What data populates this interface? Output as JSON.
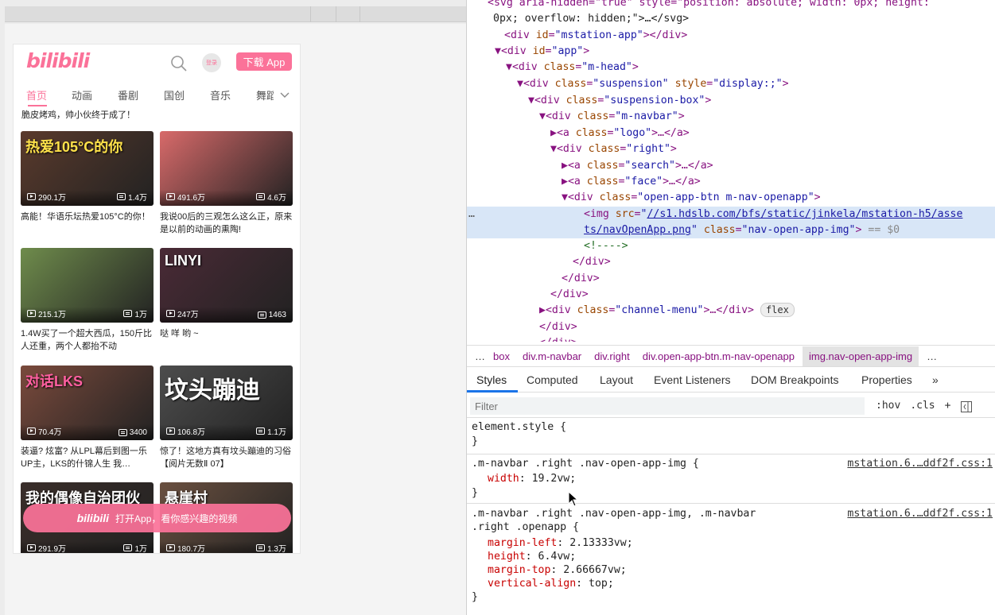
{
  "mobile": {
    "logo": "bilibili",
    "face_label": "登录",
    "open_app_label": "下载 App",
    "channels": [
      "首页",
      "动画",
      "番剧",
      "国创",
      "音乐",
      "舞蹈"
    ],
    "prev_title": "脆皮烤鸡，帅小伙终于成了！",
    "cards": [
      {
        "views": "290.1万",
        "danmaku": "1.4万",
        "title": "高能！华语乐坛热爱105°C的你！",
        "thumb_text": "热爱105°C的你",
        "bg": "#5a3a2c"
      },
      {
        "views": "491.6万",
        "danmaku": "4.6万",
        "title": "我说00后的三观怎么这么正，原来是以前的动画的熏陶!",
        "thumb_text": "",
        "bg": "#d86a6a"
      },
      {
        "views": "215.1万",
        "danmaku": "1万",
        "title": "1.4W买了一个超大西瓜，150斤比人还重，两个人都抬不动",
        "thumb_text": "",
        "bg": "#6f8c4c"
      },
      {
        "views": "247万",
        "danmaku": "1463",
        "title": "哒 咩 哟 ~",
        "thumb_text": "LINYI",
        "bg": "#4a2a36"
      },
      {
        "views": "70.4万",
        "danmaku": "3400",
        "title": "装逼? 炫富? 从LPL幕后到图一乐UP主，LKS的什锦人生 我…",
        "thumb_text": "对话LKS",
        "bg": "#7a4a3c"
      },
      {
        "views": "106.8万",
        "danmaku": "1.1万",
        "title": "惊了！这地方真有坟头蹦迪的习俗【阅片无数Ⅱ 07】",
        "thumb_text": "坟头蹦迪",
        "bg": "#4d4d4d"
      },
      {
        "views": "291.9万",
        "danmaku": "1万",
        "title": "",
        "thumb_text": "我的偶像自治团伙",
        "bg": "#3a2e2a"
      },
      {
        "views": "180.7万",
        "danmaku": "1.3万",
        "title": "",
        "thumb_text": "悬崖村",
        "bg": "#6a5040"
      }
    ],
    "float_banner": {
      "logo": "bilibili",
      "text": "打开App，看你感兴趣的视频"
    }
  },
  "devtools": {
    "elements": {
      "line0": "<svg aria-hidden=\"true\" style=\"position: absolute; width: 0px; height:",
      "line0b": "0px; overflow: hidden;\">…</svg>",
      "mstation": "mstation-app",
      "app": "app",
      "m_head": "m-head",
      "suspension": "suspension",
      "suspension_style": "display:;",
      "suspension_box": "suspension-box",
      "m_navbar": "m-navbar",
      "logo": "logo",
      "right": "right",
      "search": "search",
      "face": "face",
      "open_app_btn": "open-app-btn m-nav-openapp",
      "img_src_1": "//s1.hdslb.com/bfs/static/jinkela/mstation-h5/asse",
      "img_src_2": "ts/navOpenApp.png",
      "img_class": "nav-open-app-img",
      "dollar": "== $0",
      "comment": "<!---->",
      "channel_menu": "channel-menu",
      "flex_badge": "flex"
    },
    "breadcrumb": [
      "…",
      "box",
      "div.m-navbar",
      "div.right",
      "div.open-app-btn.m-nav-openapp",
      "img.nav-open-app-img",
      "…"
    ],
    "tabs": [
      "Styles",
      "Computed",
      "Layout",
      "Event Listeners",
      "DOM Breakpoints",
      "Properties",
      "»"
    ],
    "filter_placeholder": "Filter",
    "filter_tools": [
      ":hov",
      ".cls",
      "+"
    ],
    "rules": {
      "element_style": "element.style {",
      "close": "}",
      "r1_selector": ".m-navbar .right .nav-open-app-img {",
      "r1_source": "mstation.6.…ddf2f.css:1",
      "r1_prop": "width",
      "r1_val": "19.2vw;",
      "r2_selector_1": ".m-navbar .right .nav-open-app-img, .m-navbar",
      "r2_selector_2": ".right .openapp {",
      "r2_source": "mstation.6.…ddf2f.css:1",
      "r2_props": [
        {
          "p": "margin-left",
          "v": "2.13333vw;"
        },
        {
          "p": "height",
          "v": "6.4vw;"
        },
        {
          "p": "margin-top",
          "v": "2.66667vw;"
        },
        {
          "p": "vertical-align",
          "v": "top;"
        }
      ]
    }
  }
}
